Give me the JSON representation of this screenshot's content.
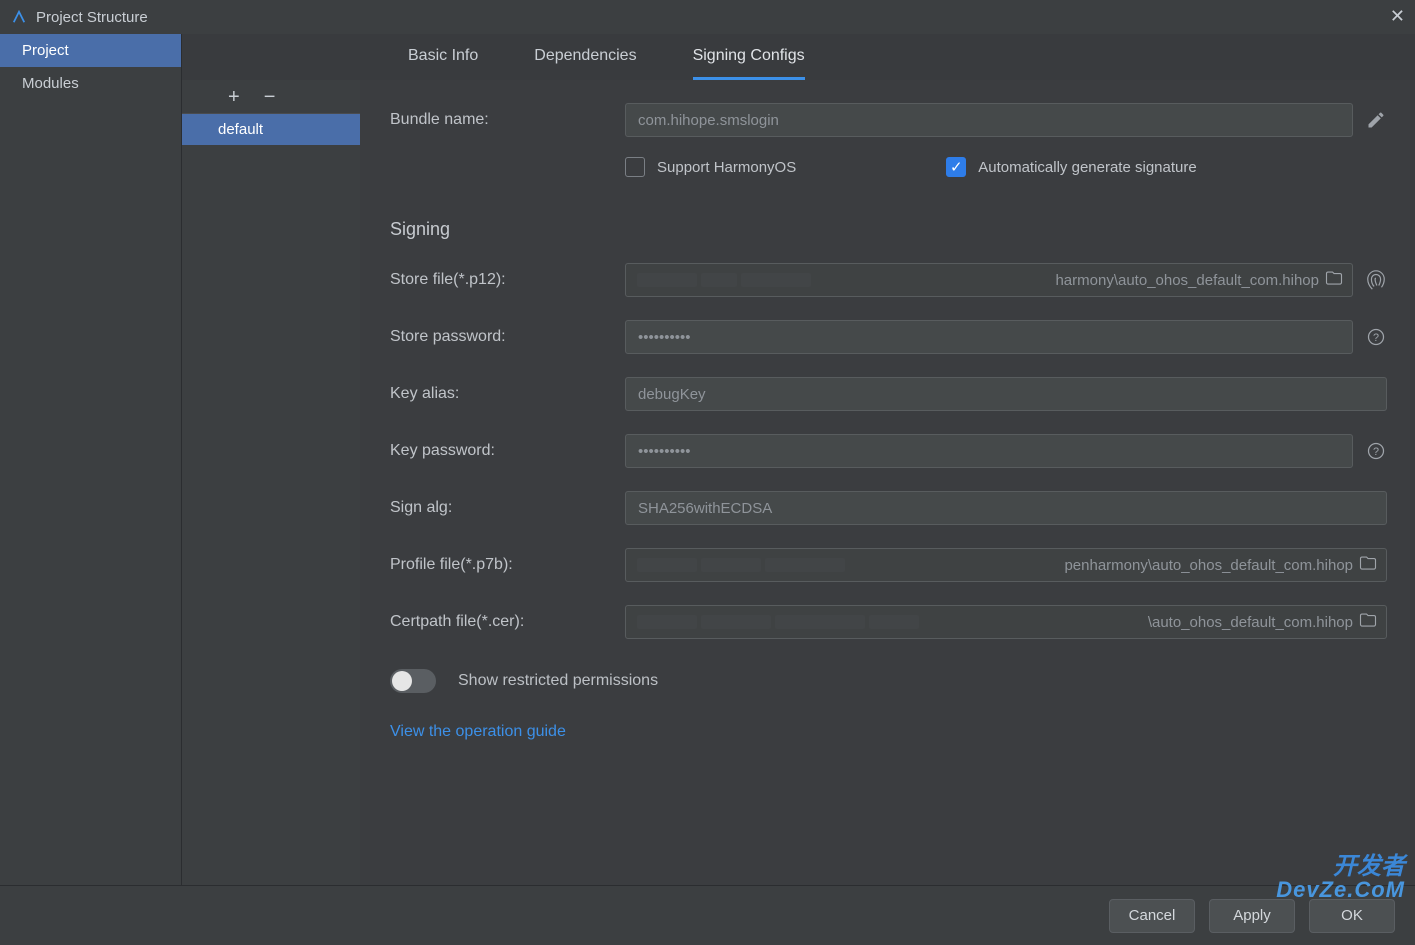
{
  "window": {
    "title": "Project Structure"
  },
  "leftNav": {
    "items": [
      "Project",
      "Modules"
    ],
    "selected": 0
  },
  "tabs": {
    "items": [
      "Basic Info",
      "Dependencies",
      "Signing Configs"
    ],
    "active": 2
  },
  "configs": {
    "items": [
      "default"
    ],
    "selected": 0
  },
  "form": {
    "bundleName": {
      "label": "Bundle name:",
      "value": "com.hihope.smslogin"
    },
    "supportHarmony": {
      "label": "Support HarmonyOS",
      "checked": false
    },
    "autoGen": {
      "label": "Automatically generate signature",
      "checked": true
    },
    "sectionTitle": "Signing",
    "storeFile": {
      "label": "Store file(*.p12):",
      "value": "harmony\\auto_ohos_default_com.hihop"
    },
    "storePassword": {
      "label": "Store password:",
      "value": "••••••••••"
    },
    "keyAlias": {
      "label": "Key alias:",
      "value": "debugKey"
    },
    "keyPassword": {
      "label": "Key password:",
      "value": "••••••••••"
    },
    "signAlg": {
      "label": "Sign alg:",
      "value": "SHA256withECDSA"
    },
    "profileFile": {
      "label": "Profile file(*.p7b):",
      "value": "penharmony\\auto_ohos_default_com.hihop"
    },
    "certFile": {
      "label": "Certpath file(*.cer):",
      "value": "\\auto_ohos_default_com.hihop"
    },
    "restricted": {
      "label": "Show restricted permissions",
      "on": false
    },
    "guideLink": "View the operation guide"
  },
  "footer": {
    "cancel": "Cancel",
    "apply": "Apply",
    "ok": "OK"
  },
  "watermark": {
    "line1": "开发者",
    "line2": "DevZe.CoM"
  }
}
